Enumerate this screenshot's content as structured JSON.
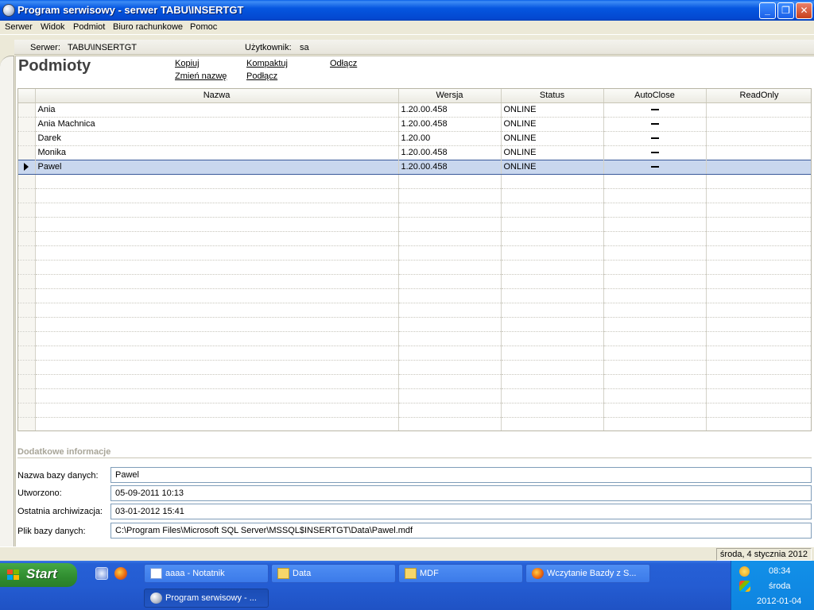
{
  "window": {
    "title": "Program serwisowy - serwer TABU\\INSERTGT",
    "min_glyph": "_",
    "max_glyph": "❐",
    "close_glyph": "✕"
  },
  "menu": [
    "Serwer",
    "Widok",
    "Podmiot",
    "Biuro rachunkowe",
    "Pomoc"
  ],
  "info": {
    "server_label": "Serwer:",
    "server_value": "TABU\\INSERTGT",
    "user_label": "Użytkownik:",
    "user_value": "sa"
  },
  "page": {
    "title": "Podmioty",
    "actions": {
      "copy": "Kopiuj",
      "rename": "Zmień nazwę",
      "compact": "Kompaktuj",
      "attach": "Podłącz",
      "detach": "Odłącz"
    }
  },
  "grid": {
    "columns": [
      "Nazwa",
      "Wersja",
      "Status",
      "AutoClose",
      "ReadOnly"
    ],
    "rows": [
      {
        "name": "Ania",
        "version": "1.20.00.458",
        "status": "ONLINE",
        "autoclose": true,
        "readonly": false
      },
      {
        "name": "Ania Machnica",
        "version": "1.20.00.458",
        "status": "ONLINE",
        "autoclose": true,
        "readonly": false
      },
      {
        "name": "Darek",
        "version": "1.20.00",
        "status": "ONLINE",
        "autoclose": true,
        "readonly": false
      },
      {
        "name": "Monika",
        "version": "1.20.00.458",
        "status": "ONLINE",
        "autoclose": true,
        "readonly": false
      },
      {
        "name": "Pawel",
        "version": "1.20.00.458",
        "status": "ONLINE",
        "autoclose": true,
        "readonly": false,
        "selected": true
      }
    ]
  },
  "details": {
    "title": "Dodatkowe informacje",
    "db_name_label": "Nazwa bazy danych:",
    "db_name_value": "Pawel",
    "created_label": "Utworzono:",
    "created_value": "05-09-2011 10:13",
    "archived_label": "Ostatnia archiwizacja:",
    "archived_value": "03-01-2012 15:41",
    "file_label": "Plik bazy danych:",
    "file_value": "C:\\Program Files\\Microsoft SQL Server\\MSSQL$INSERTGT\\Data\\Pawel.mdf"
  },
  "statusbar": {
    "date": "środa, 4 stycznia 2012"
  },
  "taskbar": {
    "start": "Start",
    "tasks": [
      {
        "label": "aaaa - Notatnik",
        "icon": "notepad-icon"
      },
      {
        "label": "Data",
        "icon": "folder-icon"
      },
      {
        "label": "MDF",
        "icon": "folder-icon"
      },
      {
        "label": "Wczytanie Bazdy z S...",
        "icon": "firefox-icon"
      },
      {
        "label": "Program serwisowy - ...",
        "icon": "app-icon",
        "active": true
      }
    ],
    "tray": {
      "time": "08:34",
      "day": "środa",
      "date": "2012-01-04"
    }
  }
}
